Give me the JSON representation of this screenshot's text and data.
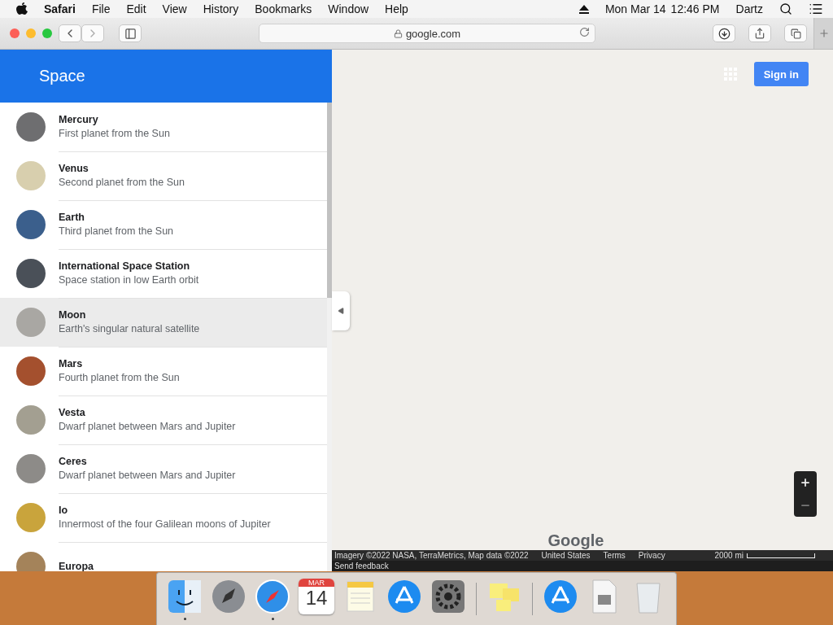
{
  "menubar": {
    "app": "Safari",
    "menus": [
      "File",
      "Edit",
      "View",
      "History",
      "Bookmarks",
      "Window",
      "Help"
    ],
    "date": "Mon Mar 14",
    "time": "12:46 PM",
    "user": "Dartz"
  },
  "browser": {
    "url": "google.com"
  },
  "sidebar": {
    "title": "Space",
    "items": [
      {
        "title": "Mercury",
        "subtitle": "First planet from the Sun",
        "color": "#6e6e70",
        "hovered": false
      },
      {
        "title": "Venus",
        "subtitle": "Second planet from the Sun",
        "color": "#d8cfae",
        "hovered": false
      },
      {
        "title": "Earth",
        "subtitle": "Third planet from the Sun",
        "color": "#3b5f8c",
        "hovered": false
      },
      {
        "title": "International Space Station",
        "subtitle": "Space station in low Earth orbit",
        "color": "#4a5058",
        "hovered": false
      },
      {
        "title": "Moon",
        "subtitle": "Earth's singular natural satellite",
        "color": "#a9a7a3",
        "hovered": true
      },
      {
        "title": "Mars",
        "subtitle": "Fourth planet from the Sun",
        "color": "#a4502e",
        "hovered": false
      },
      {
        "title": "Vesta",
        "subtitle": "Dwarf planet between Mars and Jupiter",
        "color": "#a39f91",
        "hovered": false
      },
      {
        "title": "Ceres",
        "subtitle": "Dwarf planet between Mars and Jupiter",
        "color": "#8d8b88",
        "hovered": false
      },
      {
        "title": "Io",
        "subtitle": "Innermost of the four Galilean moons of Jupiter",
        "color": "#c9a43c",
        "hovered": false
      },
      {
        "title": "Europa",
        "color": "#a4835a",
        "hovered": false
      }
    ]
  },
  "map": {
    "sign_in": "Sign in",
    "logo": "Google",
    "attribution": "Imagery ©2022 NASA, TerraMetrics, Map data ©2022",
    "links": [
      "United States",
      "Terms",
      "Privacy"
    ],
    "scale": "2000 mi",
    "feedback": "Send feedback"
  },
  "dock": {
    "items": [
      {
        "kind": "finder",
        "running": true
      },
      {
        "kind": "launchpad",
        "running": false
      },
      {
        "kind": "safari",
        "running": true
      },
      {
        "kind": "calendar",
        "running": false,
        "month": "MAR",
        "day": "14"
      },
      {
        "kind": "notes",
        "running": false
      },
      {
        "kind": "appstore",
        "running": false
      },
      {
        "kind": "settings",
        "running": false
      },
      {
        "kind": "separator"
      },
      {
        "kind": "stickies",
        "running": false
      },
      {
        "kind": "separator"
      },
      {
        "kind": "appstore",
        "running": false
      },
      {
        "kind": "disk",
        "running": false
      },
      {
        "kind": "trash",
        "running": false
      }
    ]
  }
}
